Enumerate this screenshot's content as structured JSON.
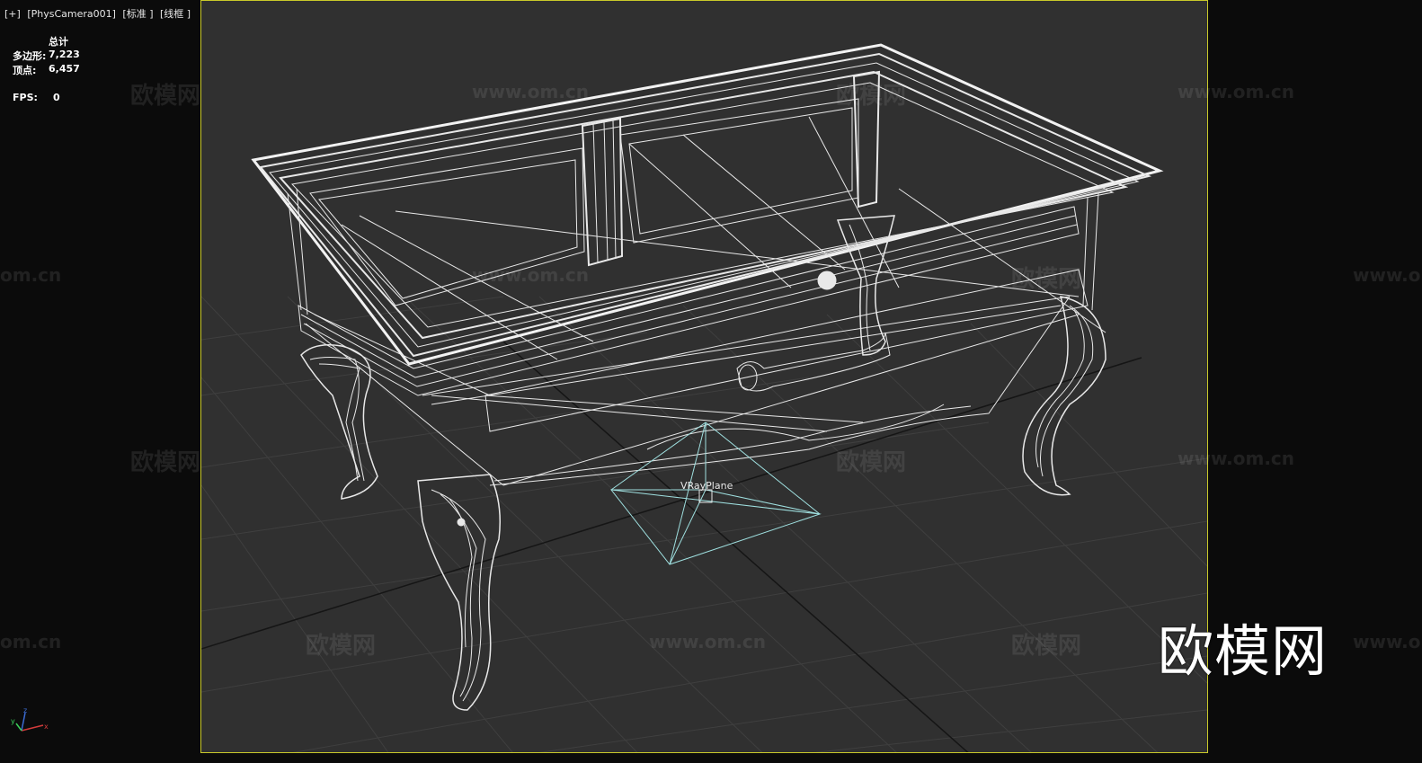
{
  "viewport": {
    "menu": "[+]",
    "camera": "[PhysCamera001]",
    "shading_mode": "[标准 ]",
    "display_mode": "[线框 ]"
  },
  "stats": {
    "header": "总计",
    "polygons_label": "多边形:",
    "polygons_value": "7,223",
    "vertices_label": "顶点:",
    "vertices_value": "6,457",
    "fps_label": "FPS:",
    "fps_value": "0"
  },
  "scene": {
    "object_label": "VRayPlane"
  },
  "watermarks": {
    "brand": "欧模网",
    "url": "www.om.cn",
    "url_fragment": "om.cn"
  },
  "logo": {
    "text": "欧模网"
  },
  "gizmo": {
    "x": "x",
    "y": "y",
    "z": "z"
  },
  "colors": {
    "frame_border": "#c9c92a",
    "viewport_bg": "#303030",
    "outer_bg": "#0b0b0b",
    "wire": "#e8e8e8",
    "grid": "#3e3e3e",
    "light_gizmo": "#9fe0e0"
  }
}
